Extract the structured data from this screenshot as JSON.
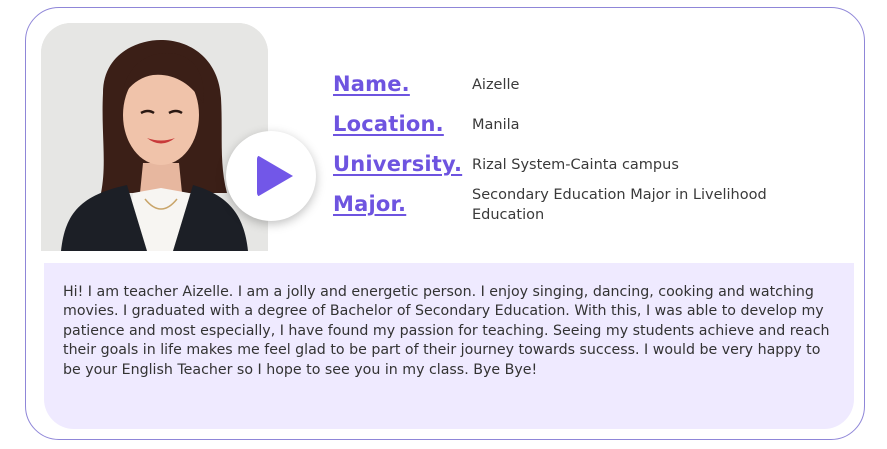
{
  "colors": {
    "accent": "#6e54e0",
    "play": "#7257e8",
    "bio_background": "#efeaff",
    "border": "#8f86d8"
  },
  "media": {
    "play_icon": "play-icon"
  },
  "profile": {
    "rows": [
      {
        "label": "Name.",
        "value": "Aizelle"
      },
      {
        "label": "Location.",
        "value": "Manila"
      },
      {
        "label": "University.",
        "value": "Rizal System-Cainta campus"
      },
      {
        "label": "Major.",
        "value": "Secondary Education Major in Livelihood Education"
      }
    ]
  },
  "bio": "Hi! I am teacher Aizelle. I am a jolly and energetic person. I enjoy singing, dancing, cooking and watching movies. I graduated with a degree of Bachelor of Secondary Education. With this, I was able to develop my patience and most especially, I have found my passion for teaching. Seeing my students achieve and reach their goals in life makes me feel glad to be part of their journey towards success. I would be very happy to be your English Teacher so I hope to see you in my class. Bye Bye!"
}
